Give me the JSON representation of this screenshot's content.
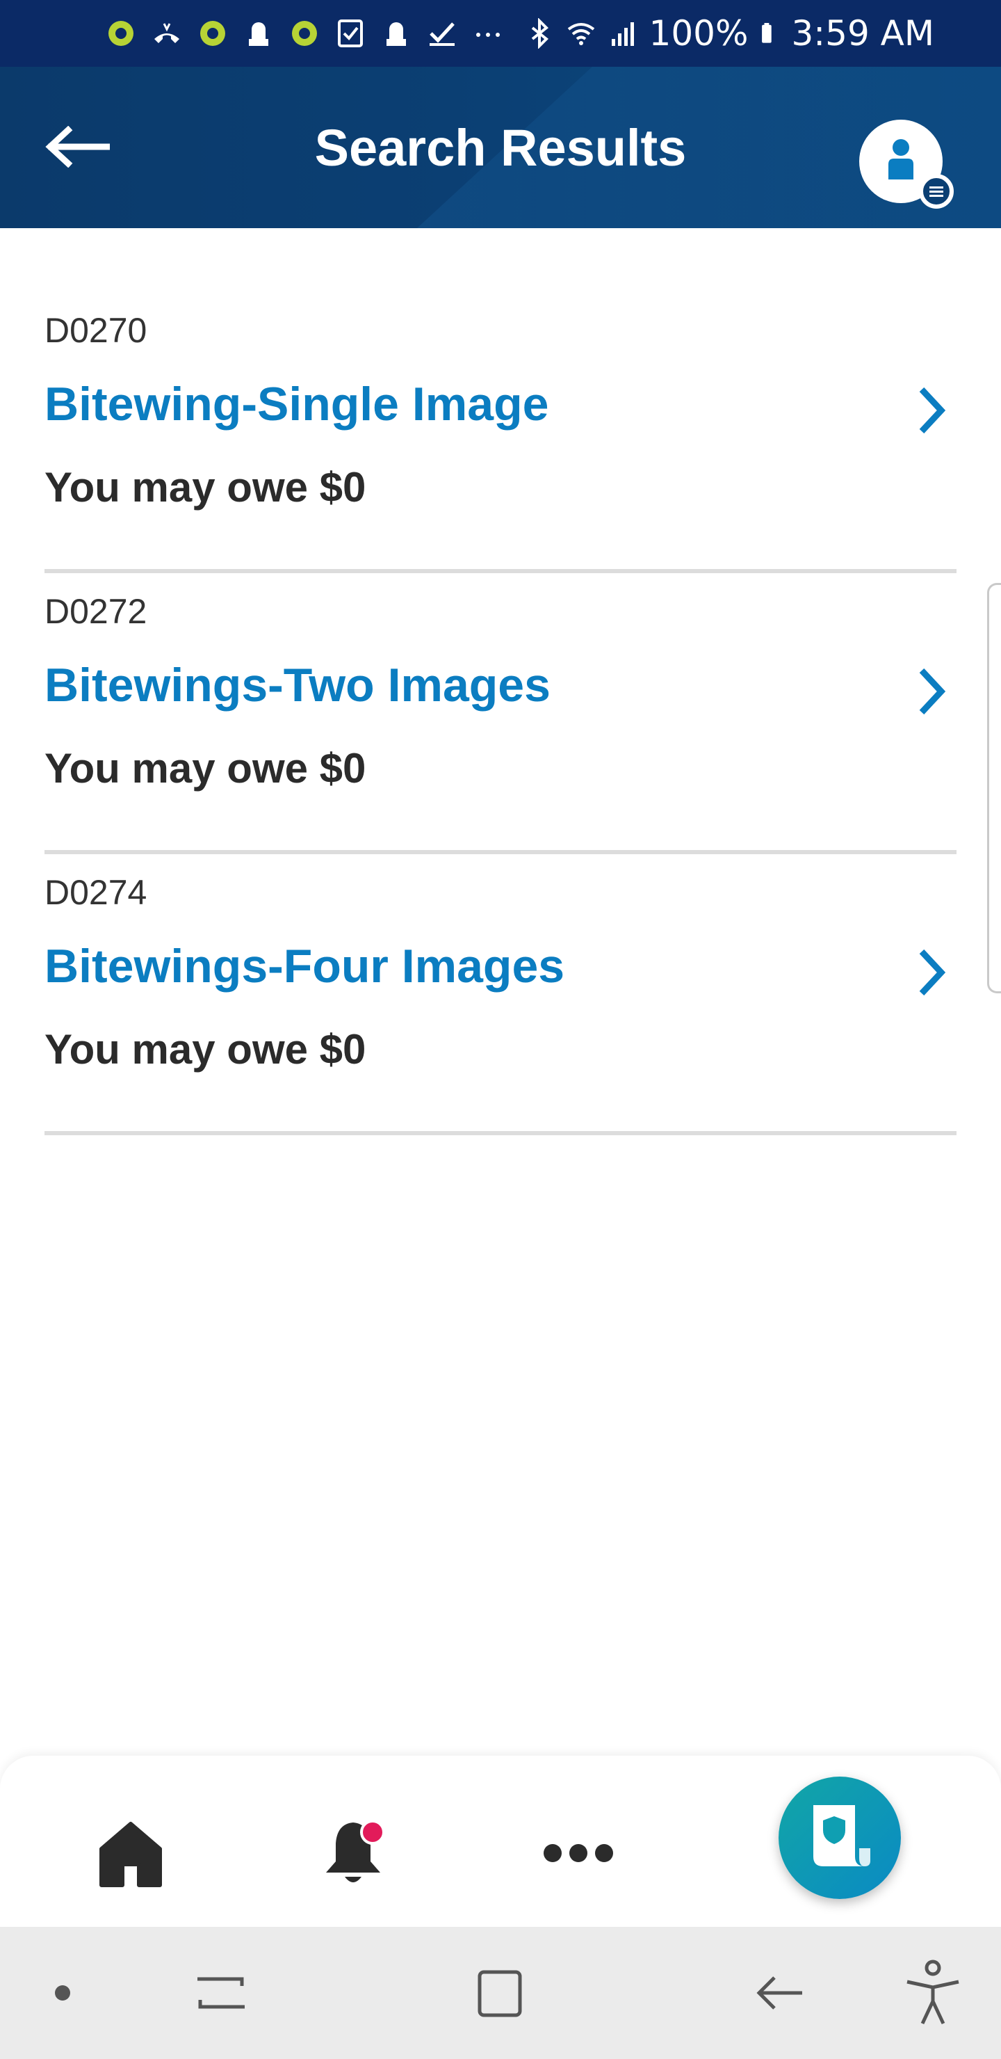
{
  "status_bar": {
    "battery": "100%",
    "time": "3:59 AM",
    "icons": [
      "app-icon",
      "call-icon",
      "app-icon",
      "lock-icon",
      "app-icon",
      "checklist-icon",
      "lock-icon",
      "check-icon",
      "more-icon",
      "bluetooth-icon",
      "wifi-icon",
      "signal-icon",
      "battery-icon"
    ],
    "background": "#0b2a66"
  },
  "header": {
    "title": "Search Results",
    "back_icon": "arrow-left-icon",
    "profile_icon": "user-icon",
    "background": "#0b3f73"
  },
  "results": [
    {
      "code": "D0270",
      "title": "Bitewing-Single Image",
      "owe": "You may owe $0"
    },
    {
      "code": "D0272",
      "title": "Bitewings-Two Images",
      "owe": "You may owe $0"
    },
    {
      "code": "D0274",
      "title": "Bitewings-Four Images",
      "owe": "You may owe $0"
    }
  ],
  "colors": {
    "accent": "#0b7dc1",
    "notification": "#e21b5a",
    "fab": "#0f9fb2"
  },
  "bottom_nav": {
    "items": [
      "home-icon",
      "bell-icon",
      "more-horizontal-icon",
      "id-card-icon"
    ]
  },
  "system_nav": {
    "items": [
      "dot-icon",
      "recent-apps-icon",
      "home-square-icon",
      "back-icon",
      "accessibility-icon"
    ]
  }
}
